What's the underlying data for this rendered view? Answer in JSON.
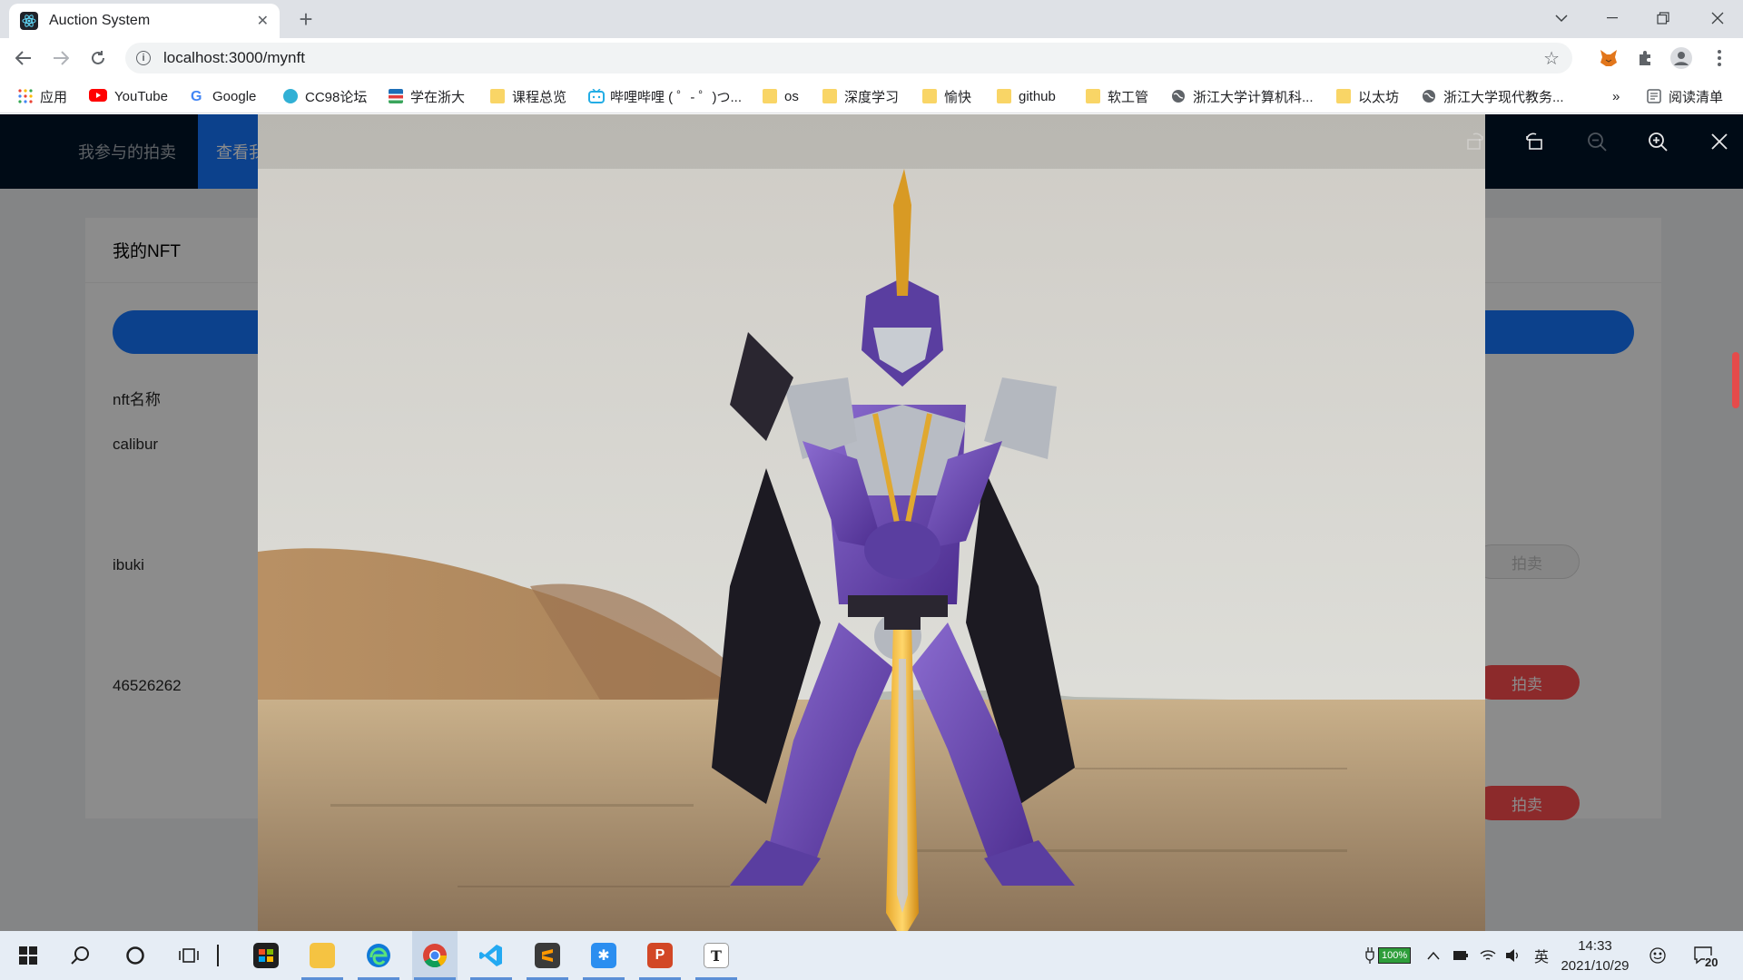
{
  "browser": {
    "tab_title": "Auction System",
    "url": "localhost:3000/mynft",
    "bookmarks": [
      "应用",
      "YouTube",
      "Google",
      "CC98论坛",
      "学在浙大",
      "课程总览",
      "哔哩哔哩 ( ゜- ゜)つ...",
      "os",
      "深度学习",
      "愉快",
      "github",
      "软工管",
      "浙江大学计算机科...",
      "以太坊",
      "浙江大学现代教务..."
    ],
    "more_bookmarks": "»",
    "reading_list": "阅读清单"
  },
  "app": {
    "nav": [
      "我参与的拍卖",
      "查看我"
    ],
    "card_title": "我的NFT",
    "column_header": "nft名称",
    "rows": [
      {
        "name": "calibur",
        "action": "拍卖"
      },
      {
        "name": "ibuki",
        "action": "拍卖"
      },
      {
        "name": "46526262",
        "action": "拍卖"
      }
    ]
  },
  "taskbar": {
    "battery": "100%",
    "ime": "英",
    "time": "14:33",
    "date": "2021/10/29",
    "notifications": "20"
  },
  "colors": {
    "primary": "#1677ff",
    "nav_bg": "#001529",
    "danger": "#ff4d4f"
  }
}
